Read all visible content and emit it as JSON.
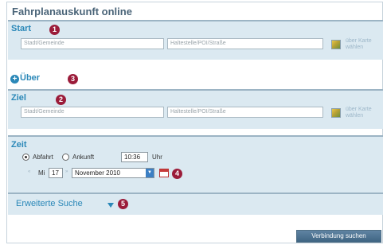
{
  "title": "Fahrplanauskunft online",
  "start": {
    "label": "Start",
    "badge": "1",
    "city_placeholder": "Stadt/Gemeinde",
    "stop_placeholder": "Haltestelle/POI/Straße",
    "map_link_line1": "über Karte",
    "map_link_line2": "wählen"
  },
  "via": {
    "label": "Über",
    "badge": "3",
    "icon": "plus-circle-icon"
  },
  "ziel": {
    "label": "Ziel",
    "badge": "2",
    "city_placeholder": "Stadt/Gemeinde",
    "stop_placeholder": "Haltestelle/POI/Straße",
    "map_link_line1": "über Karte",
    "map_link_line2": "wählen"
  },
  "zeit": {
    "label": "Zeit",
    "departure_label": "Abfahrt",
    "arrival_label": "Ankunft",
    "selected": "Abfahrt",
    "time_value": "10:36",
    "time_unit": "Uhr",
    "prev_arrow": "«",
    "next_arrow": "»",
    "weekday": "Mi",
    "day": "17",
    "month_year": "November 2010",
    "badge": "4"
  },
  "advanced": {
    "label": "Erweiterte Suche",
    "badge": "5"
  },
  "submit_label": "Verbindung suchen",
  "colors": {
    "accent": "#2b88b8",
    "band": "#dbe9f1",
    "badge": "#9b1c3a",
    "title": "#4a6478"
  }
}
